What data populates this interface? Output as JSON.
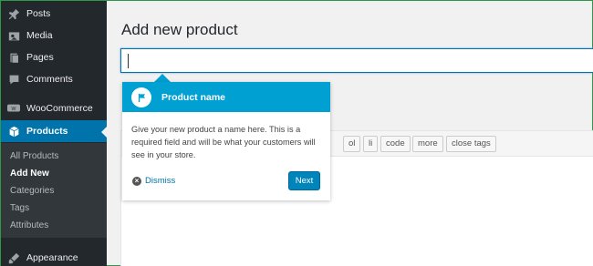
{
  "sidebar": {
    "items": [
      {
        "label": "Posts",
        "icon": "pin-icon"
      },
      {
        "label": "Media",
        "icon": "media-icon"
      },
      {
        "label": "Pages",
        "icon": "pages-icon"
      },
      {
        "label": "Comments",
        "icon": "comments-icon"
      },
      {
        "label": "WooCommerce",
        "icon": "woocommerce-icon"
      },
      {
        "label": "Products",
        "icon": "products-icon"
      },
      {
        "label": "Appearance",
        "icon": "appearance-icon"
      }
    ],
    "submenu": [
      "All Products",
      "Add New",
      "Categories",
      "Tags",
      "Attributes"
    ]
  },
  "main": {
    "page_title": "Add new product",
    "title_input_value": ""
  },
  "toolbar": {
    "buttons": [
      "ol",
      "li",
      "code",
      "more",
      "close tags"
    ]
  },
  "tour": {
    "title": "Product name",
    "body": "Give your new product a name here. This is a required field and will be what your customers will see in your store.",
    "dismiss_label": "Dismiss",
    "next_label": "Next"
  },
  "colors": {
    "sidebar_bg": "#23282d",
    "active": "#0073aa",
    "tour_header": "#00a0d2",
    "next_button": "#0085ba"
  }
}
